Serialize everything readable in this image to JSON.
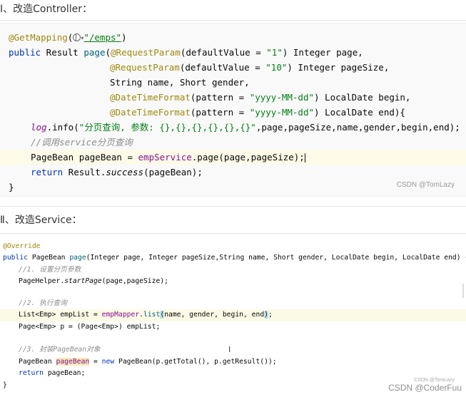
{
  "section1": {
    "heading": "Ⅰ、改造Controller："
  },
  "section2": {
    "heading": "Ⅱ、改造Service："
  },
  "code1": {
    "l1": {
      "ann": "@GetMapping",
      "open": "(",
      "url": "\"/emps\"",
      "close": ")"
    },
    "l2": {
      "kw": "public",
      "t1": " Result ",
      "fn": "page",
      "t2": "(",
      "ann": "@RequestParam",
      "t3": "(defaultValue = ",
      "str": "\"1\"",
      "t4": ") Integer page,"
    },
    "l3": {
      "ann": "@RequestParam",
      "t1": "(defaultValue = ",
      "str": "\"10\"",
      "t2": ") Integer pageSize,"
    },
    "l4": {
      "t1": "String name, Short gender,"
    },
    "l5": {
      "ann": "@DateTimeFormat",
      "t1": "(pattern = ",
      "str": "\"yyyy-MM-dd\"",
      "t2": ") LocalDate begin,"
    },
    "l6": {
      "ann": "@DateTimeFormat",
      "t1": "(pattern = ",
      "str": "\"yyyy-MM-dd\"",
      "t2": ") LocalDate end){"
    },
    "l7": {
      "log": "log",
      "t1": ".info(",
      "str": "\"分页查询, 参数: {},{},{},{},{},{}\"",
      "t2": ",page,pageSize,name,gender,begin,end);"
    },
    "l8": {
      "cm": "//调用service分页查询"
    },
    "l9": {
      "t1": "PageBean pageBean = ",
      "fld": "empService",
      "t2": ".page(page,pageSize);"
    },
    "l10": {
      "kw": "return",
      "t1": " Result.",
      "it": "success",
      "t2": "(pageBean);"
    },
    "l11": {
      "t1": "}"
    }
  },
  "code2": {
    "l1": {
      "ann": "@Override"
    },
    "l2": {
      "kw": "public",
      "t1": " PageBean ",
      "fn": "page",
      "t2": "(Integer page, Integer pageSize,String name, Short gender, LocalDate begin, LocalDate end) {"
    },
    "l3": {
      "cm": "//1. 设置分页参数"
    },
    "l4": {
      "t1": "PageHelper.",
      "it": "startPage",
      "t2": "(page,pageSize);"
    },
    "l5": {
      "cm": "//2. 执行查询"
    },
    "l6": {
      "t1": "List<Emp> empList = ",
      "fld": "empMapper",
      "t2": ".",
      "fn": "list",
      "p1": "(",
      "t3": "name, gender, begin, end",
      "p2": ")",
      "t4": ";"
    },
    "l7": {
      "t1": "Page<Emp> p = (Page<Emp>) empList;"
    },
    "l8": {
      "cm": "//3. 封装PageBean对象"
    },
    "l9": {
      "t1": "PageBean ",
      "mk": "pageBean",
      "t2": " = ",
      "kw": "new",
      "t3": " PageBean(p.getTotal(), p.getResult());"
    },
    "l10": {
      "kw": "return",
      "t1": " pageBean;"
    },
    "l11": {
      "t1": "}"
    }
  },
  "watermarks": {
    "w1": "CSDN @TomLazy",
    "w2": "CSDN @TomLazy",
    "w3": "CSDN @CoderFuu"
  },
  "icons": {
    "globe": "globe-icon",
    "chevron": "chevron-down-icon"
  },
  "colors": {
    "keyword": "#0033b3",
    "annotation": "#9e880d",
    "string": "#067d17",
    "comment": "#8c8c8c",
    "field": "#871094"
  }
}
